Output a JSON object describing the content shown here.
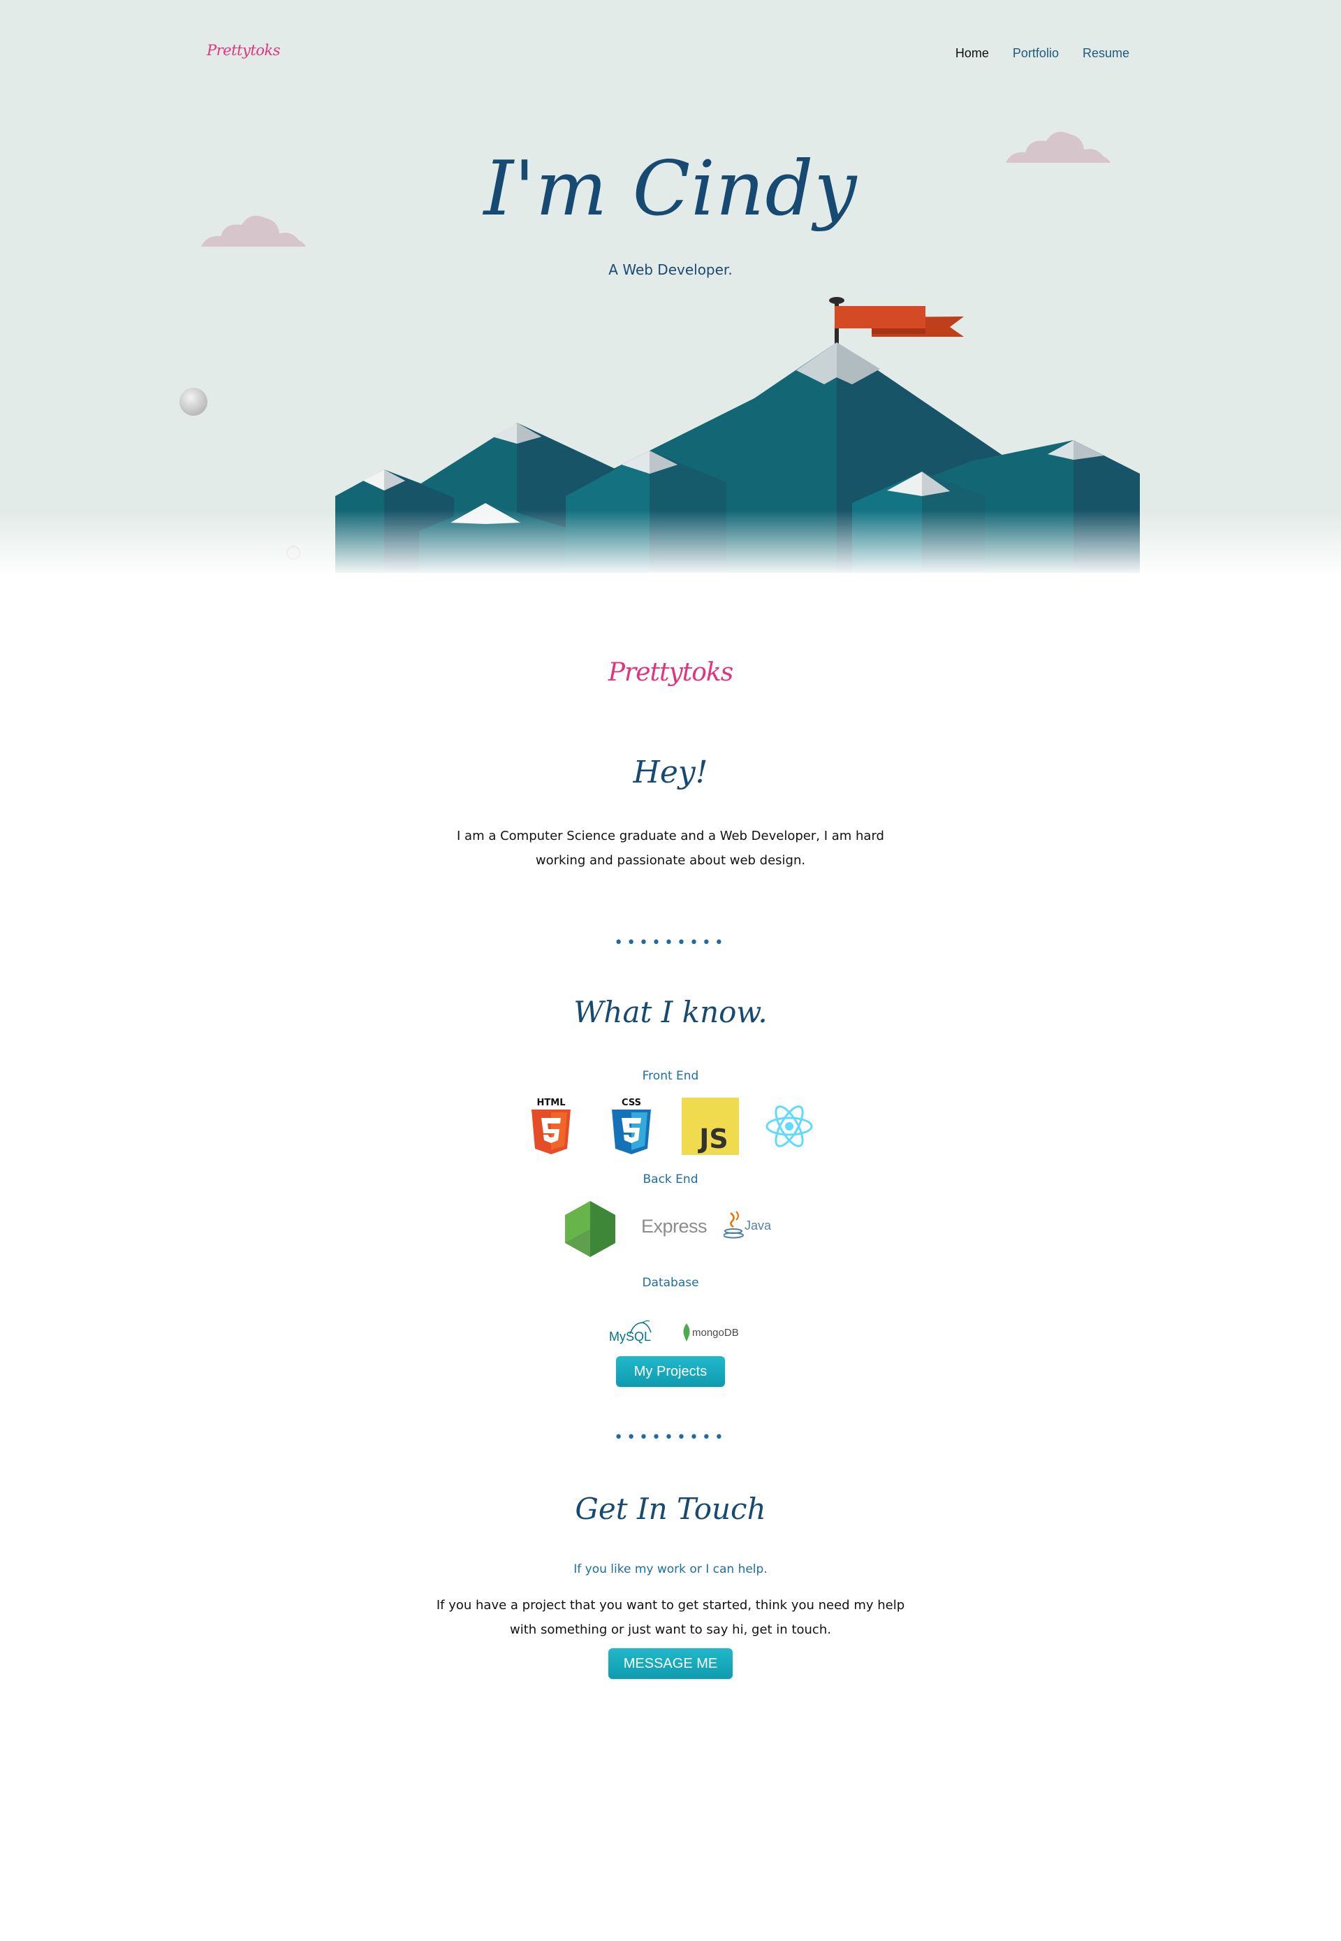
{
  "header": {
    "logo": "Prettytoks",
    "nav": [
      {
        "label": "Home"
      },
      {
        "label": "Portfolio"
      },
      {
        "label": "Resume"
      }
    ]
  },
  "hero": {
    "title": "I'm Cindy",
    "subtitle": "A Web Developer."
  },
  "brand": "Prettytoks",
  "about": {
    "heading": "Hey!",
    "text_line1": "I am a Computer Science graduate and a Web Developer, I am hard",
    "text_line2": "working and passionate about web design."
  },
  "divider": "•••••••••",
  "skills": {
    "heading": "What I know.",
    "front_end_label": "Front End",
    "front_end_icons": [
      "html5-icon",
      "css3-icon",
      "javascript-icon",
      "react-icon"
    ],
    "back_end_label": "Back End",
    "back_end_icons": [
      "nodejs-icon",
      "express-icon",
      "java-icon"
    ],
    "express_text": "Express",
    "java_text": "Java",
    "database_label": "Database",
    "database_icons": [
      "mysql-icon",
      "mongodb-icon"
    ],
    "mysql_text": "MySQL",
    "mongodb_text": "mongoDB",
    "projects_button": "My Projects"
  },
  "contact": {
    "heading": "Get In Touch",
    "subheading": "If you like my work or I can help.",
    "text_line1": "If you have a project that you want to get started, think you need my help",
    "text_line2": "with something or just want to say hi, get in touch.",
    "button": "MESSAGE ME"
  },
  "colors": {
    "hero_bg": "#e2ebe7",
    "brand_pink": "#e2337e",
    "heading_blue": "#174a72",
    "accent_blue": "#1d6ea5",
    "button_teal": "#15a9bc",
    "mountain_teal": "#136775",
    "flag_red": "#c94a20"
  }
}
